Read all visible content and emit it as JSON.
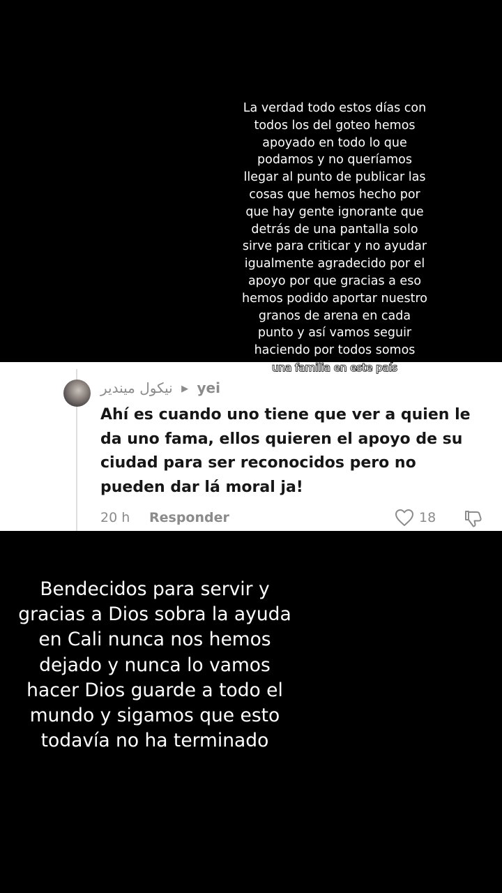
{
  "top_caption": {
    "lines": [
      "La verdad todo estos días con",
      "todos los del goteo hemos",
      "apoyado en  todo lo que",
      "podamos y no queríamos",
      "llegar al punto de publicar las",
      "cosas que hemos hecho  por",
      "que  hay gente ignorante que",
      "detrás de una pantalla solo",
      "sirve para criticar y no ayudar",
      "igualmente agradecido por el",
      "apoyo por que gracias a eso",
      "hemos podido aportar nuestro",
      "granos de arena en cada",
      "punto y así vamos seguir",
      "haciendo por todos somos"
    ],
    "highlight": "una familia en este país"
  },
  "comment": {
    "author": "نيكول ميندير",
    "arrow": "▶",
    "reply_to": "yei",
    "text_lines": [
      "Ahí es cuando uno tiene que ver a quien le",
      "da uno fama, ellos quieren el apoyo de su",
      "ciudad para ser reconocidos pero no",
      "pueden dar lá moral ja!"
    ],
    "time": "20 h",
    "reply_label": "Responder",
    "likes": "18",
    "icons": [
      "heart-icon",
      "dislike-icon"
    ]
  },
  "bottom_caption": {
    "lines": [
      "Bendecidos para servir y",
      "gracias a Dios sobra la ayuda",
      "en Cali nunca nos hemos",
      "dejado y nunca lo vamos",
      "hacer Dios guarde a todo el",
      "mundo y sigamos que esto",
      "todavía no ha terminado"
    ]
  },
  "colors": {
    "background": "#000000",
    "card": "#ffffff",
    "comment_text": "#161616",
    "meta_text": "#8b8b8b"
  }
}
